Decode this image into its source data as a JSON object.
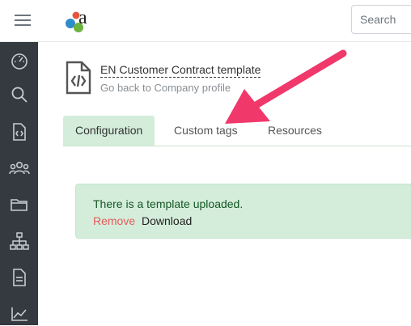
{
  "topbar": {
    "menu_icon": "hamburger-menu-icon",
    "logo_letter": "a",
    "search": {
      "placeholder": "Search",
      "value": ""
    }
  },
  "sidebar": {
    "items": [
      {
        "icon": "dashboard-gauge-icon"
      },
      {
        "icon": "search-icon"
      },
      {
        "icon": "code-file-icon"
      },
      {
        "icon": "users-group-icon"
      },
      {
        "icon": "folder-icon"
      },
      {
        "icon": "org-chart-icon"
      },
      {
        "icon": "document-icon"
      },
      {
        "icon": "area-chart-icon"
      }
    ]
  },
  "header": {
    "icon": "code-file-icon",
    "title": "EN Customer Contract template",
    "back_link": "Go back to Company profile"
  },
  "tabs": [
    {
      "label": "Configuration",
      "active": true
    },
    {
      "label": "Custom tags",
      "active": false
    },
    {
      "label": "Resources",
      "active": false
    }
  ],
  "alert": {
    "message": "There is a template uploaded.",
    "remove_label": "Remove",
    "download_label": "Download"
  },
  "colors": {
    "sidebar_bg": "#343a40",
    "alert_bg": "#d4edda",
    "alert_text": "#155724",
    "remove_text": "#e35d5b",
    "annotation_arrow": "#f0386b"
  }
}
